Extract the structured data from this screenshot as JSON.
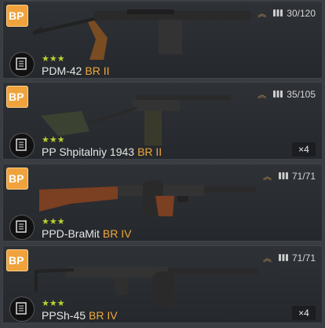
{
  "items": [
    {
      "name": "PDM-42",
      "br": "BR II",
      "stars": "★★★",
      "ammo": "30/120",
      "count": null
    },
    {
      "name": "PP Shpitalniy 1943",
      "br": "BR II",
      "stars": "★★★",
      "ammo": "35/105",
      "count": "×4"
    },
    {
      "name": "PPD-BraMit",
      "br": "BR IV",
      "stars": "★★★",
      "ammo": "71/71",
      "count": null
    },
    {
      "name": "PPSh-45",
      "br": "BR IV",
      "stars": "★★★",
      "ammo": "71/71",
      "count": "×4"
    }
  ],
  "colors": {
    "accent": "#f2a93b",
    "badge": "#f0a23c",
    "stars": "#b8d233"
  },
  "icons": [
    "bp-badge-icon",
    "manual-icon",
    "rank-chevron-icon",
    "ammo-icon"
  ]
}
